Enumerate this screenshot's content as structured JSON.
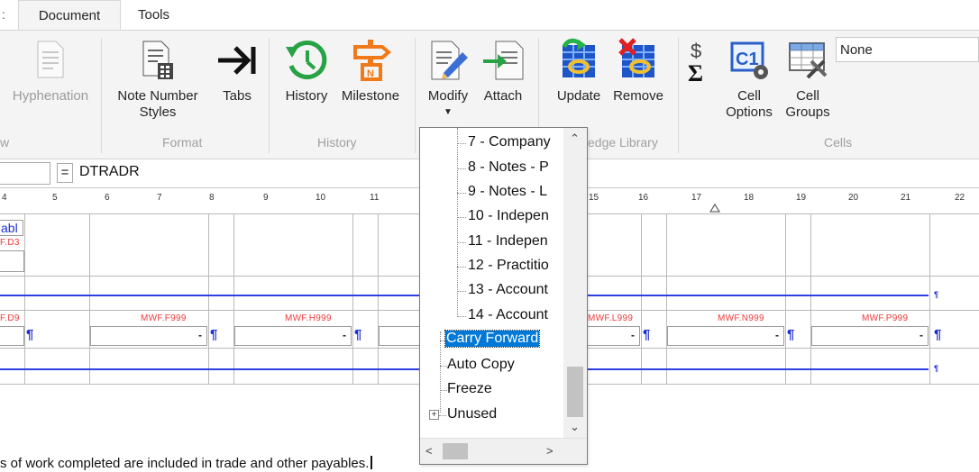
{
  "tabs": [
    {
      "label": "Document"
    },
    {
      "label": "Tools"
    }
  ],
  "ribbon": {
    "buttons": {
      "hyphenation": "Hyphenation",
      "note_number_styles_1": "Note Number",
      "note_number_styles_2": "Styles",
      "tabs": "Tabs",
      "history": "History",
      "milestone": "Milestone",
      "modify": "Modify",
      "attach": "Attach",
      "update": "Update",
      "remove": "Remove",
      "cell_options_1": "Cell",
      "cell_options_2": "Options",
      "cell_groups_1": "Cell",
      "cell_groups_2": "Groups"
    },
    "groups": {
      "view_partial": "w",
      "format": "Format",
      "history": "History",
      "knowledge_partial": "edge Library",
      "cells": "Cells"
    },
    "style_select_value": "None"
  },
  "formula": {
    "eq": "=",
    "value": "DTRADR"
  },
  "ruler": [
    "4",
    "5",
    "6",
    "7",
    "8",
    "9",
    "10",
    "11",
    "15",
    "16",
    "17",
    "18",
    "19",
    "20",
    "21",
    "22"
  ],
  "sheet": {
    "top_cell_label": "abl",
    "top_cell_ref": "F.D3",
    "row_refs": [
      "F.D9",
      "MWF.F999",
      "MWF.H999",
      "MWF.L999",
      "MWF.N999",
      "MWF.P999"
    ],
    "dash": "-",
    "pilcrow": "¶",
    "bottom_text": "s of work completed are included in trade and other payables."
  },
  "dropdown": {
    "items": [
      "7 - Company",
      "8 - Notes - P",
      "9 - Notes  - L",
      "10 - Indepen",
      "11 - Indepen",
      "12 - Practitio",
      "13 - Account",
      "14 - Account",
      "Carry Forward",
      "Auto Copy",
      "Freeze",
      "Unused"
    ],
    "selected": "Carry Forward"
  },
  "colors": {
    "accent_blue": "#2f3fe0",
    "ref_red": "#ee3a3a",
    "selection": "#0078d7"
  }
}
